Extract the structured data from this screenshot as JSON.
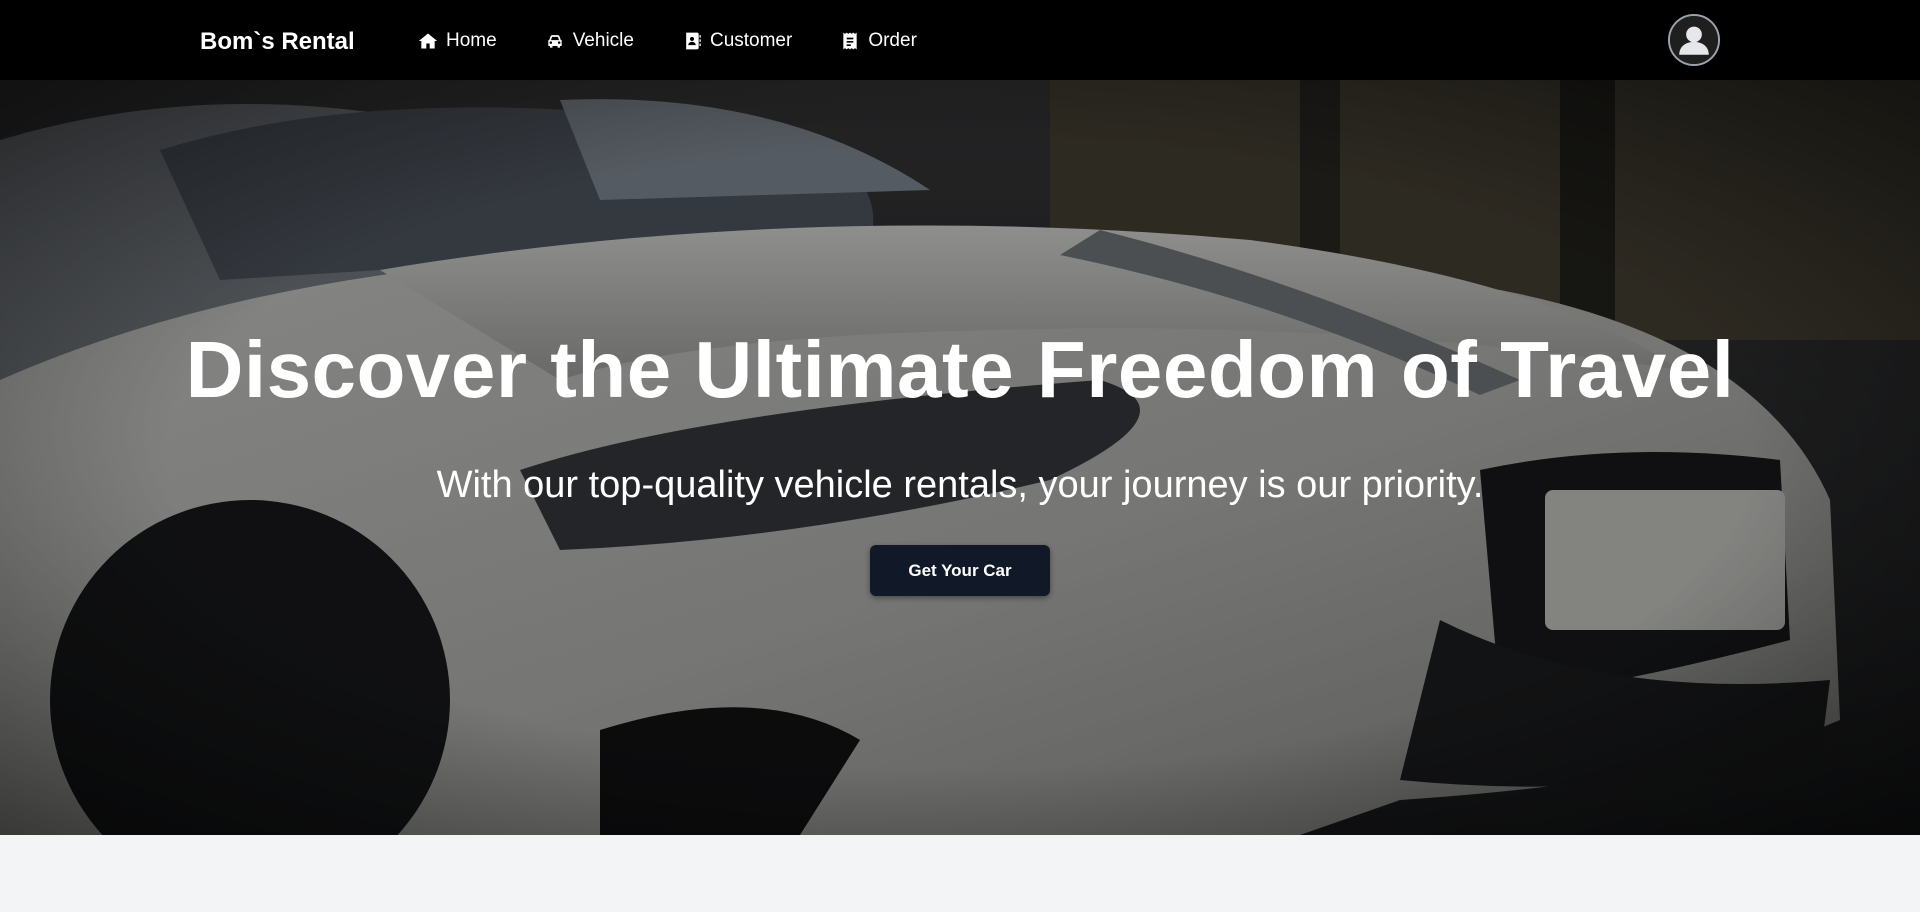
{
  "brand": {
    "name": "Bom`s Rental"
  },
  "nav": {
    "items": [
      {
        "label": "Home",
        "icon": "home-icon"
      },
      {
        "label": "Vehicle",
        "icon": "car-icon"
      },
      {
        "label": "Customer",
        "icon": "address-book-icon"
      },
      {
        "label": "Order",
        "icon": "receipt-icon"
      }
    ]
  },
  "user": {
    "icon": "user-avatar-icon"
  },
  "hero": {
    "title": "Discover the Ultimate Freedom of Travel",
    "subtitle": "With our top-quality vehicle rentals, your journey is our priority.",
    "cta_label": "Get Your Car",
    "background": "white sports car photo"
  },
  "colors": {
    "navbar_bg": "#000000",
    "button_bg": "#111827",
    "page_bg": "#f3f4f6",
    "text": "#ffffff"
  }
}
